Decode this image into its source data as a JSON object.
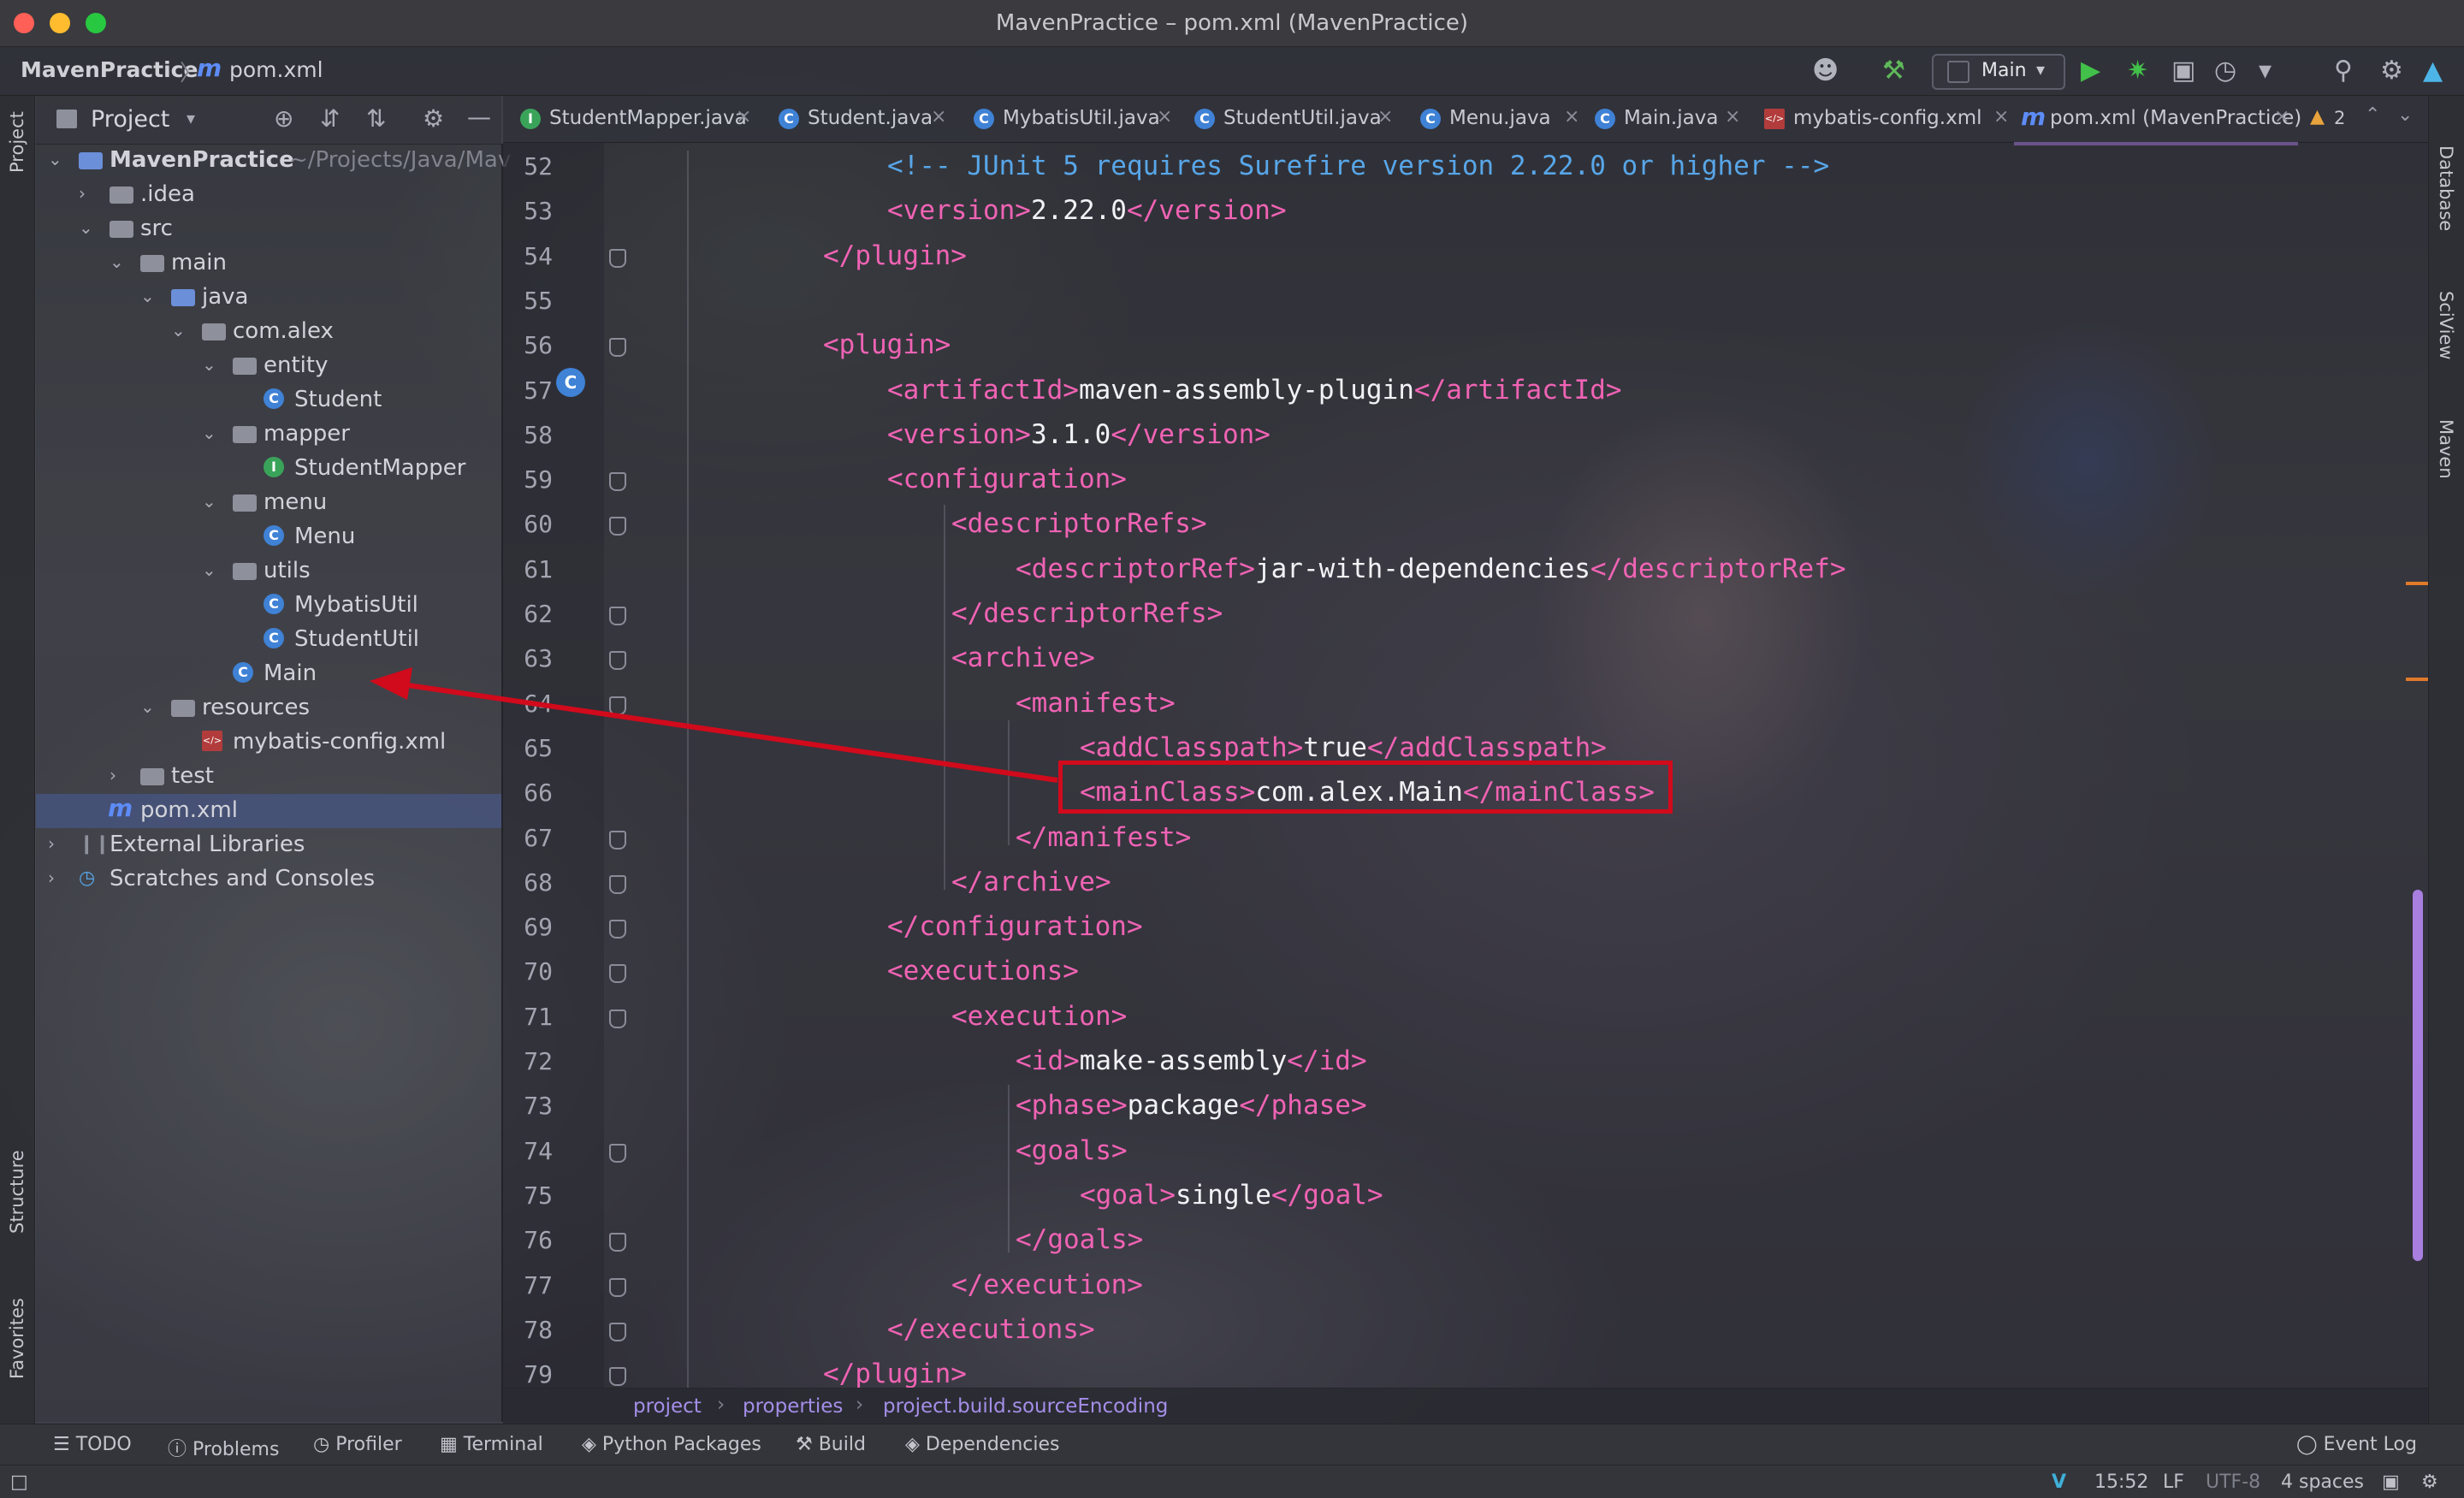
{
  "window": {
    "title": "MavenPractice – pom.xml (MavenPractice)"
  },
  "navbar": {
    "project": "MavenPractice",
    "separator": "〉",
    "file_icon": "m",
    "file": "pom.xml",
    "run_config": "Main"
  },
  "left_strip": {
    "project": "Project",
    "structure": "Structure",
    "favorites": "Favorites"
  },
  "right_strip": {
    "database": "Database",
    "sciview": "SciView",
    "maven": "Maven"
  },
  "project_panel": {
    "title": "Project",
    "items": [
      {
        "label": "MavenPractice",
        "path": "~/Projects/Java/Mav"
      },
      {
        "label": ".idea"
      },
      {
        "label": "src"
      },
      {
        "label": "main"
      },
      {
        "label": "java"
      },
      {
        "label": "com.alex"
      },
      {
        "label": "entity"
      },
      {
        "label": "Student"
      },
      {
        "label": "mapper"
      },
      {
        "label": "StudentMapper"
      },
      {
        "label": "menu"
      },
      {
        "label": "Menu"
      },
      {
        "label": "utils"
      },
      {
        "label": "MybatisUtil"
      },
      {
        "label": "StudentUtil"
      },
      {
        "label": "Main"
      },
      {
        "label": "resources"
      },
      {
        "label": "mybatis-config.xml"
      },
      {
        "label": "test"
      },
      {
        "label": "pom.xml"
      },
      {
        "label": "External Libraries"
      },
      {
        "label": "Scratches and Consoles"
      }
    ]
  },
  "tabs": [
    {
      "label": "StudentMapper.java",
      "icon": "I"
    },
    {
      "label": "Student.java",
      "icon": "C"
    },
    {
      "label": "MybatisUtil.java",
      "icon": "C"
    },
    {
      "label": "StudentUtil.java",
      "icon": "C"
    },
    {
      "label": "Menu.java",
      "icon": "C"
    },
    {
      "label": "Main.java",
      "icon": "C"
    },
    {
      "label": "mybatis-config.xml",
      "icon": "xml"
    },
    {
      "label": "pom.xml (MavenPractice)",
      "icon": "m"
    }
  ],
  "editor": {
    "warnings": "2",
    "lines": [
      {
        "n": "52",
        "indent": 2,
        "parts": [
          [
            "cmt",
            "<!-- JUnit 5 requires Surefire version 2.22.0 or higher -->"
          ]
        ]
      },
      {
        "n": "53",
        "indent": 2,
        "parts": [
          [
            "tag",
            "<version>"
          ],
          [
            "txt",
            "2.22.0"
          ],
          [
            "tag",
            "</version>"
          ]
        ]
      },
      {
        "n": "54",
        "indent": 1,
        "parts": [
          [
            "tag",
            "</plugin>"
          ]
        ]
      },
      {
        "n": "55",
        "indent": 0,
        "parts": []
      },
      {
        "n": "56",
        "indent": 1,
        "parts": [
          [
            "tag",
            "<plugin>"
          ]
        ]
      },
      {
        "n": "57",
        "indent": 2,
        "parts": [
          [
            "tag",
            "<artifactId>"
          ],
          [
            "txt",
            "maven-assembly-plugin"
          ],
          [
            "tag",
            "</artifactId>"
          ]
        ]
      },
      {
        "n": "58",
        "indent": 2,
        "parts": [
          [
            "tag",
            "<version>"
          ],
          [
            "txt",
            "3.1.0"
          ],
          [
            "tag",
            "</version>"
          ]
        ]
      },
      {
        "n": "59",
        "indent": 2,
        "parts": [
          [
            "tag",
            "<configuration>"
          ]
        ]
      },
      {
        "n": "60",
        "indent": 3,
        "parts": [
          [
            "tag",
            "<descriptorRefs>"
          ]
        ]
      },
      {
        "n": "61",
        "indent": 4,
        "parts": [
          [
            "tag",
            "<descriptorRef>"
          ],
          [
            "txt",
            "jar-with-dependencies"
          ],
          [
            "tag",
            "</descriptorRef>"
          ]
        ]
      },
      {
        "n": "62",
        "indent": 3,
        "parts": [
          [
            "tag",
            "</descriptorRefs>"
          ]
        ]
      },
      {
        "n": "63",
        "indent": 3,
        "parts": [
          [
            "tag",
            "<archive>"
          ]
        ]
      },
      {
        "n": "64",
        "indent": 4,
        "parts": [
          [
            "tag",
            "<manifest>"
          ]
        ]
      },
      {
        "n": "65",
        "indent": 5,
        "parts": [
          [
            "tag",
            "<addClasspath>"
          ],
          [
            "txt",
            "true"
          ],
          [
            "tag",
            "</addClasspath>"
          ]
        ]
      },
      {
        "n": "66",
        "indent": 5,
        "parts": [
          [
            "tag",
            "<mainClass>"
          ],
          [
            "txt",
            "com.alex.Main"
          ],
          [
            "tag",
            "</mainClass>"
          ]
        ]
      },
      {
        "n": "67",
        "indent": 4,
        "parts": [
          [
            "tag",
            "</manifest>"
          ]
        ]
      },
      {
        "n": "68",
        "indent": 3,
        "parts": [
          [
            "tag",
            "</archive>"
          ]
        ]
      },
      {
        "n": "69",
        "indent": 2,
        "parts": [
          [
            "tag",
            "</configuration>"
          ]
        ]
      },
      {
        "n": "70",
        "indent": 2,
        "parts": [
          [
            "tag",
            "<executions>"
          ]
        ]
      },
      {
        "n": "71",
        "indent": 3,
        "parts": [
          [
            "tag",
            "<execution>"
          ]
        ]
      },
      {
        "n": "72",
        "indent": 4,
        "parts": [
          [
            "tag",
            "<id>"
          ],
          [
            "txt",
            "make-assembly"
          ],
          [
            "tag",
            "</id>"
          ]
        ]
      },
      {
        "n": "73",
        "indent": 4,
        "parts": [
          [
            "tag",
            "<phase>"
          ],
          [
            "txt",
            "package"
          ],
          [
            "tag",
            "</phase>"
          ]
        ]
      },
      {
        "n": "74",
        "indent": 4,
        "parts": [
          [
            "tag",
            "<goals>"
          ]
        ]
      },
      {
        "n": "75",
        "indent": 5,
        "parts": [
          [
            "tag",
            "<goal>"
          ],
          [
            "txt",
            "single"
          ],
          [
            "tag",
            "</goal>"
          ]
        ]
      },
      {
        "n": "76",
        "indent": 4,
        "parts": [
          [
            "tag",
            "</goals>"
          ]
        ]
      },
      {
        "n": "77",
        "indent": 3,
        "parts": [
          [
            "tag",
            "</execution>"
          ]
        ]
      },
      {
        "n": "78",
        "indent": 2,
        "parts": [
          [
            "tag",
            "</executions>"
          ]
        ]
      },
      {
        "n": "79",
        "indent": 1,
        "parts": [
          [
            "tag",
            "</plugin>"
          ]
        ]
      }
    ]
  },
  "breadcrumbs": [
    "project",
    "properties",
    "project.build.sourceEncoding"
  ],
  "bottom_tools": [
    "TODO",
    "Problems",
    "Profiler",
    "Terminal",
    "Python Packages",
    "Build",
    "Dependencies",
    "Event Log"
  ],
  "status": {
    "time": "15:52",
    "line_sep": "LF",
    "encoding": "UTF-8",
    "indent": "4 spaces"
  },
  "colors": {
    "tag": "#f063b4",
    "comment": "#58a6e8",
    "annotation": "#d10a1c",
    "accent": "#a87fe0"
  },
  "icons": [
    "search-icon",
    "gear-icon",
    "run-icon",
    "debug-icon",
    "build-hammer-icon",
    "user-icon"
  ]
}
